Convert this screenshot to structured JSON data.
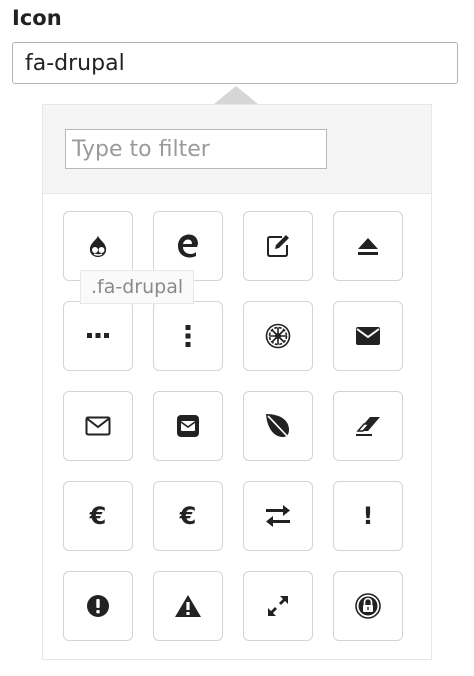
{
  "field": {
    "label": "Icon",
    "value": "fa-drupal"
  },
  "picker": {
    "filter_placeholder": "Type to filter",
    "tooltip": ".fa-drupal",
    "icons": [
      {
        "name": "drupal-icon"
      },
      {
        "name": "edge-icon"
      },
      {
        "name": "edit-icon"
      },
      {
        "name": "eject-icon"
      },
      {
        "name": "ellipsis-h-icon"
      },
      {
        "name": "ellipsis-v-icon"
      },
      {
        "name": "empire-icon"
      },
      {
        "name": "envelope-icon"
      },
      {
        "name": "envelope-o-icon"
      },
      {
        "name": "envelope-square-icon"
      },
      {
        "name": "envira-icon"
      },
      {
        "name": "eraser-icon"
      },
      {
        "name": "eur-icon",
        "glyph": "€"
      },
      {
        "name": "euro-icon",
        "glyph": "€"
      },
      {
        "name": "exchange-icon"
      },
      {
        "name": "exclamation-icon",
        "glyph": "!"
      },
      {
        "name": "exclamation-circle-icon"
      },
      {
        "name": "exclamation-triangle-icon"
      },
      {
        "name": "expand-icon"
      },
      {
        "name": "expeditedssl-icon"
      }
    ]
  }
}
